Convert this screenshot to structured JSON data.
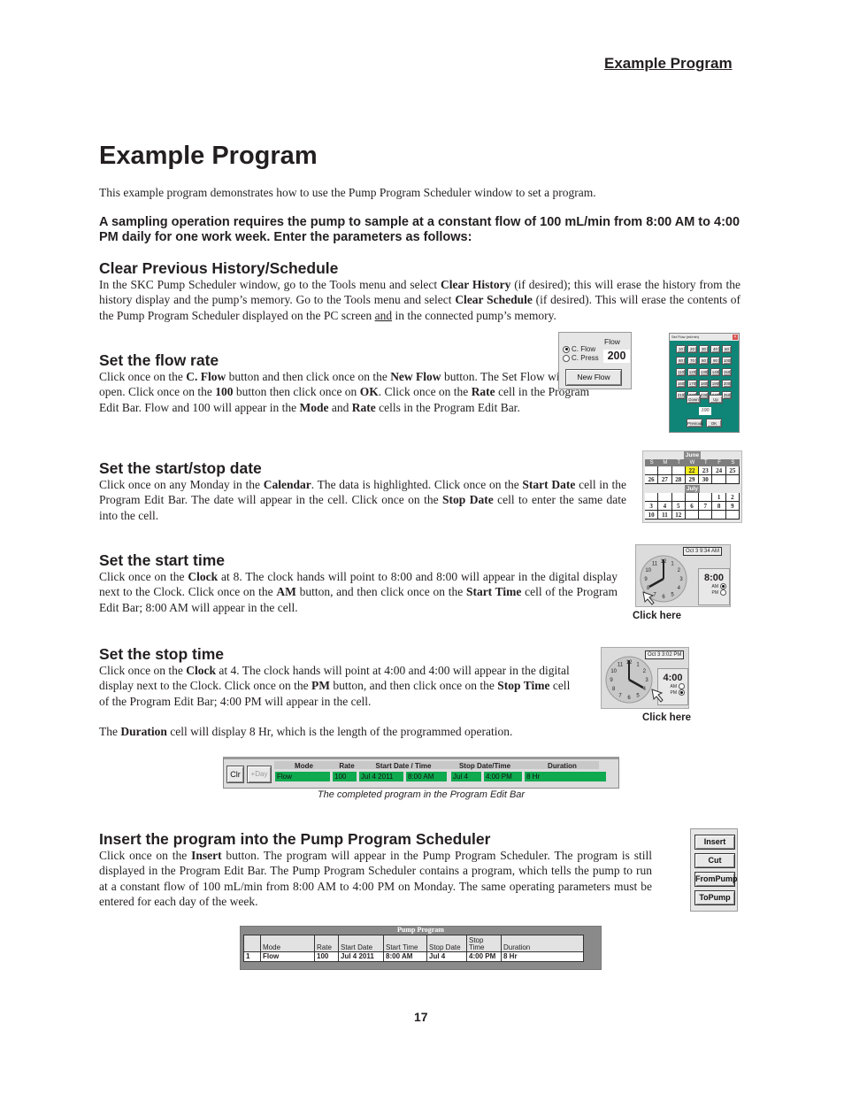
{
  "running_head": "Example Program",
  "title": "Example Program",
  "intro": "This example program demonstrates how to use the Pump Program Scheduler window to set a program.",
  "lead": "A sampling operation requires the pump to sample at a constant flow of 100 mL/min from 8:00 AM to 4:00 PM daily for one work week. Enter the parameters as follows:",
  "sections": {
    "clear": {
      "heading": "Clear Previous History/Schedule",
      "t1": "In the SKC Pump Scheduler window, go to the Tools menu and select ",
      "b1": "Clear History",
      "t2": " (if desired); this will erase the history from the history display and the pump’s memory. Go to the Tools menu and select ",
      "b2": "Clear Schedule",
      "t3": " (if desired). This will erase the contents of the Pump Program Scheduler displayed on the PC screen ",
      "u1": "and",
      "t4": " in the connected pump’s memory."
    },
    "flow": {
      "heading": "Set the flow rate",
      "t1": "Click once on the ",
      "b1": "C. Flow",
      "t2": " button and then click once on the ",
      "b2": "New Flow",
      "t3": " button. The Set Flow window will open. Click once on the ",
      "b3": "100",
      "t4": " button then click once on ",
      "b4": "OK",
      "t5": ". Click once on the ",
      "b5": "Rate",
      "t6": " cell in the Program Edit Bar. Flow and 100 will appear in the ",
      "b6": "Mode",
      "t7": " and ",
      "b7": "Rate",
      "t8": " cells in the Program Edit Bar."
    },
    "date": {
      "heading": "Set the start/stop date",
      "t1": "Click once on any Monday in the ",
      "b1": "Calendar",
      "t2": ". The data is highlighted. Click once on the ",
      "b2": "Start Date",
      "t3": " cell in the Program Edit Bar. The date will appear in the cell. Click once on the ",
      "b3": "Stop Date",
      "t4": " cell to enter the same date into the cell."
    },
    "start": {
      "heading": "Set the start time",
      "t1": "Click once on the ",
      "b1": "Clock",
      "t2": " at 8. The clock hands will point to 8:00 and 8:00 will appear in the digital display next to the Clock. Click once on the ",
      "b2": "AM",
      "t3": " button, and then click once on the ",
      "b3": "Start Time",
      "t4": " cell of the Program Edit Bar; 8:00 AM will appear in the cell."
    },
    "stop": {
      "heading": "Set the stop time",
      "t1": "Click once on the ",
      "b1": "Clock",
      "t2": " at 4. The clock hands will point at 4:00 and 4:00 will appear in the digital display next to the Clock. Click once on the ",
      "b2": "PM",
      "t3": " button, and then click once on the ",
      "b3": "Stop Time",
      "t4": " cell of the Program Edit Bar; 4:00 PM will appear in the cell.",
      "d1": "The ",
      "db": "Duration",
      "d2": " cell will display 8 Hr, which is the length of the programmed operation."
    },
    "insert": {
      "heading": "Insert the program into the Pump Program Scheduler",
      "t1": "Click once on the ",
      "b1": "Insert",
      "t2": " button. The program will appear in the Pump Program Scheduler. The program is still displayed in the Program Edit Bar. The Pump Program Scheduler contains a program, which tells the pump to run at a constant flow of 100 mL/min from 8:00 AM to 4:00 PM on Monday. The same operating parameters must be entered for each day of the week."
    }
  },
  "flow_panel": {
    "flow_label": "Flow",
    "option_flow": "C. Flow",
    "option_press": "C. Press",
    "flow_value": "200",
    "new_flow_button": "New Flow"
  },
  "set_flow_window": {
    "title": "Set Flow (ml/min)",
    "buttons": [
      "10",
      "20",
      "30",
      "40",
      "50",
      "60",
      "70",
      "80",
      "90",
      "100",
      "110",
      "120",
      "130",
      "140",
      "150",
      "160",
      "170",
      "180",
      "190",
      "200",
      "210",
      "220",
      "230",
      "240",
      "250"
    ],
    "down": "Down",
    "up": "Up",
    "display": "100",
    "previous": "Previous",
    "ok": "OK"
  },
  "calendar": {
    "month1": "June",
    "month2": "July",
    "weekdays": [
      "S",
      "M",
      "T",
      "W",
      "T",
      "F",
      "S"
    ],
    "june_days": [
      "",
      "",
      "",
      "22",
      "23",
      "24",
      "25",
      "26",
      "27",
      "28",
      "29",
      "30",
      "",
      ""
    ],
    "july_days": [
      "",
      "",
      "",
      "",
      "",
      "1",
      "2",
      "3",
      "4",
      "5",
      "6",
      "7",
      "8",
      "9",
      "10",
      "11",
      "12",
      "",
      "",
      "",
      ""
    ],
    "selected": "22",
    "highlight_color": "#f4ee1d"
  },
  "clock_start": {
    "timestamp": "Oct 3  9:34 AM",
    "digital": "8:00",
    "am": "AM",
    "pm": "PM",
    "caption": "Click here"
  },
  "clock_stop": {
    "timestamp": "Oct 3  3:02 PM",
    "digital": "4:00",
    "am": "AM",
    "pm": "PM",
    "caption": "Click here"
  },
  "edit_bar": {
    "clr": "Clr",
    "plus_day": "+Day",
    "headers": {
      "mode": "Mode",
      "rate": "Rate",
      "start": "Start Date  /  Time",
      "stop": "Stop Date/Time",
      "duration": "Duration"
    },
    "values": {
      "mode": "Flow",
      "rate": "100",
      "start_date": "Jul 4 2011",
      "start_time": "8:00 AM",
      "stop_date": "Jul 4",
      "stop_time": "4:00 PM",
      "duration": "8 Hr"
    },
    "caption": "The completed program in the Program Edit Bar",
    "cell_color": "#0fa94f"
  },
  "action_buttons": [
    "Insert",
    "Cut",
    "FromPump",
    "ToPump"
  ],
  "pump_program": {
    "title": "Pump Program",
    "headers": [
      "",
      "Mode",
      "Rate",
      "Start Date",
      "Start Time",
      "Stop Date",
      "Stop Time",
      "Duration"
    ],
    "rows": [
      [
        "1",
        "Flow",
        "100",
        "Jul 4 2011",
        "8:00 AM",
        "Jul 4",
        "4:00 PM",
        "8 Hr"
      ]
    ]
  },
  "page_number": "17"
}
